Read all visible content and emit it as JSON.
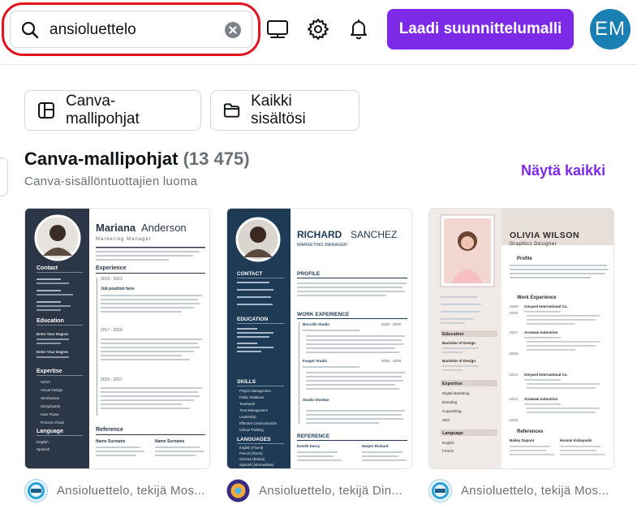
{
  "search": {
    "value": "ansioluettelo"
  },
  "header": {
    "cta_label": "Laadi suunnittelumalli",
    "avatar_initials": "EM",
    "icons": [
      "search-icon",
      "clear-icon",
      "desktop-icon",
      "gear-icon",
      "bell-icon"
    ]
  },
  "filters": [
    {
      "label": "Canva-mallipohjat",
      "icon": "template-icon"
    },
    {
      "label": "Kaikki sisältösi",
      "icon": "folder-icon"
    }
  ],
  "section": {
    "title": "Canva-mallipohjat",
    "count": "(13 475)",
    "subtitle": "Canva-sisällöntuottajien luoma",
    "see_all": "Näytä kaikki"
  },
  "colors": {
    "accent": "#7d2ae8",
    "highlight": "#e0131f",
    "avatar": "#1a7fb3"
  },
  "cards": [
    {
      "caption": "Ansioluettelo, tekijä Mos...",
      "name_first": "Mariana",
      "name_last": "Anderson",
      "role": "Marketing Manager",
      "sections": [
        "Contact",
        "Education",
        "Expertise",
        "Language"
      ],
      "main_sections": [
        "Experience",
        "Reference"
      ],
      "years": [
        "2019 - 2021",
        "2017 - 2019",
        "2015 - 2017"
      ],
      "job": "Job position here",
      "skills": [
        "UI/UX",
        "Visual Design",
        "Wireframes",
        "Storyboards",
        "User Flows",
        "Process Flows"
      ],
      "languages": [
        "English",
        "Spanish"
      ],
      "edu_items": [
        "Enter Your Degree",
        "Enter Your Degree"
      ],
      "ref_names": [
        "Name Surname",
        "Name Surname"
      ]
    },
    {
      "caption": "Ansioluettelo, tekijä Din...",
      "name_first": "RICHARD",
      "name_last": "SANCHEZ",
      "role": "MARKETING MANAGER",
      "sections": [
        "CONTACT",
        "EDUCATION",
        "SKILLS",
        "LANGUAGES"
      ],
      "main_sections": [
        "PROFILE",
        "WORK EXPERIENCE",
        "REFERENCE"
      ],
      "years": [
        "2029 - 2030",
        "2025 - 2029"
      ],
      "companies": [
        "Borcelle Studio",
        "Fauget Studio",
        "Studio Shodwe"
      ],
      "skills": [
        "Project Management",
        "Public Relations",
        "Teamwork",
        "Time Management",
        "Leadership",
        "Effective Communication",
        "Critical Thinking"
      ],
      "languages": [
        "English (Fluent)",
        "French (Fluent)",
        "German (Basics)",
        "Spanish (Intermediate)"
      ],
      "ref_names": [
        "Estelle Darcy",
        "Harper Richard"
      ]
    },
    {
      "caption": "Ansioluettelo, tekijä Mos...",
      "name": "OLIVIA WILSON",
      "role": "Graphics Designer",
      "main_sections": [
        "Profile",
        "Work Experience",
        "References"
      ],
      "side_sections": [
        "Education",
        "Expertise",
        "Language"
      ],
      "companies": [
        "Ginyard International Co.",
        "Arowwai Industries",
        "Ginyard International Co.",
        "Arowwai Industries"
      ],
      "years": [
        "2020",
        "2019",
        "2017",
        "2016",
        "2014",
        "2014",
        "2010"
      ],
      "expertise": [
        "Digital Marketing",
        "Branding",
        "Copywriting",
        "SEO"
      ],
      "languages": [
        "English",
        "French"
      ],
      "degrees": [
        "Bachelor of Design",
        "Bachelor of Design"
      ],
      "ref_names": [
        "Bailey Dupont",
        "Harumi Kobayashi"
      ]
    }
  ]
}
